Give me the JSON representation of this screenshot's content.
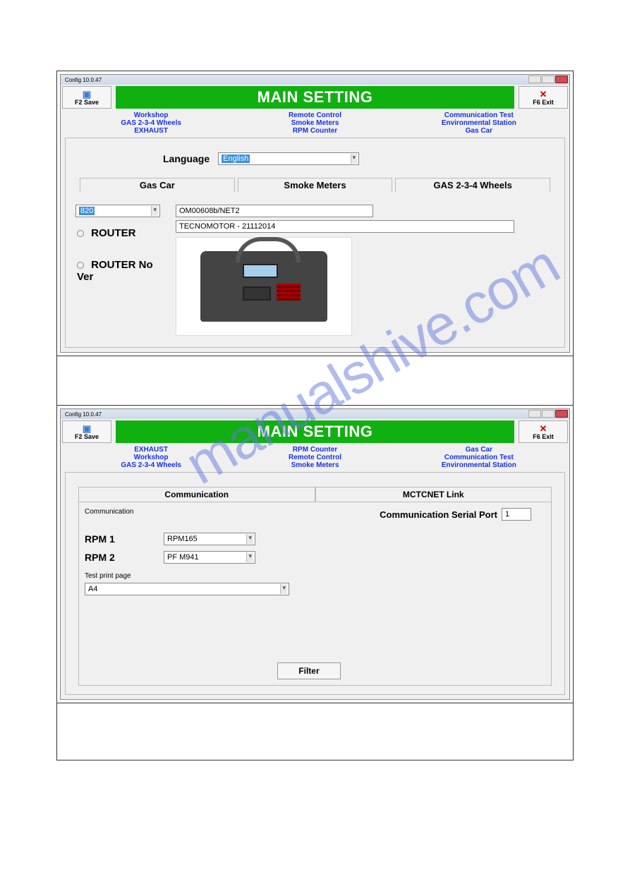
{
  "watermark": "manualshive.com",
  "screen1": {
    "window_title": "Config 10.0.47",
    "banner": "MAIN SETTING",
    "save_btn": "F2 Save",
    "exit_btn": "F6 Exit",
    "tabs_row1": [
      "Workshop",
      "Remote Control",
      "Communication Test"
    ],
    "tabs_row2": [
      "GAS 2-3-4 Wheels",
      "Smoke Meters",
      "Environmental Station"
    ],
    "tabs_row3": [
      "EXHAUST",
      "RPM Counter",
      "Gas Car"
    ],
    "language_label": "Language",
    "language_value": "English",
    "subtabs": [
      "Gas Car",
      "Smoke Meters",
      "GAS 2-3-4 Wheels"
    ],
    "model_value": "820",
    "field1": "OM00608b/NET2",
    "field2": "TECNOMOTOR - 21112014",
    "router1": "ROUTER",
    "router2": "ROUTER No Ver"
  },
  "screen2": {
    "window_title": "Config 10.0.47",
    "banner": "MAIN SETTING",
    "save_btn": "F2 Save",
    "exit_btn": "F6 Exit",
    "tabs_row1": [
      "EXHAUST",
      "RPM Counter",
      "Gas Car"
    ],
    "tabs_row2": [
      "Workshop",
      "Remote Control",
      "Communication Test"
    ],
    "tabs_row3": [
      "GAS 2-3-4 Wheels",
      "Smoke Meters",
      "Environmental Station"
    ],
    "commtabs": [
      "Communication",
      "MCTCNET Link"
    ],
    "group_label": "Communication",
    "serial_port_label": "Communication Serial Port",
    "serial_port_value": "1",
    "rpm1_label": "RPM 1",
    "rpm1_value": "RPM165",
    "rpm2_label": "RPM 2",
    "rpm2_value": "PF M941",
    "testprint_label": "Test print page",
    "testprint_value": "A4",
    "filter_btn": "Filter"
  }
}
